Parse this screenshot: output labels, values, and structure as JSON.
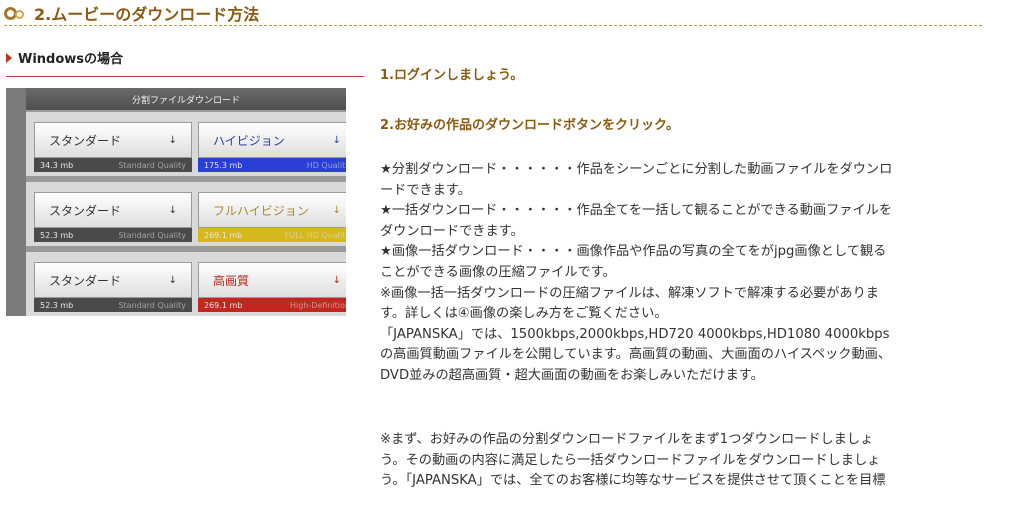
{
  "section": {
    "title": "2.ムービーのダウンロード方法"
  },
  "sub": {
    "title": "Windowsの場合"
  },
  "panel": {
    "header": "分割ファイルダウンロード",
    "arrow": "↓",
    "rows": [
      {
        "left": {
          "label": "スタンダード",
          "size": "34.3 mb",
          "quality": "Standard Quality"
        },
        "right": {
          "label": "ハイビジョン",
          "size": "175.3 mb",
          "quality": "HD Quality",
          "bar_color": "#2a3fd6",
          "label_color": "#2b3fa8"
        }
      },
      {
        "left": {
          "label": "スタンダード",
          "size": "52.3 mb",
          "quality": "Standard Quality"
        },
        "right": {
          "label": "フルハイビジョン",
          "size": "269.1 mb",
          "quality": "FULL HD Quality",
          "bar_color": "#d4b81c",
          "label_color": "#a88a2a"
        }
      },
      {
        "left": {
          "label": "スタンダード",
          "size": "52.3 mb",
          "quality": "Standard Quality"
        },
        "right": {
          "label": "高画質",
          "size": "269.1 mb",
          "quality": "High-Definition",
          "bar_color": "#c2261e",
          "label_color": "#b02a20"
        }
      }
    ]
  },
  "steps": {
    "s1": "1.ログインしましょう。",
    "s2": "2.お好みの作品のダウンロードボタンをクリック。"
  },
  "body": {
    "lines": [
      "★分割ダウンロード・・・・・・作品をシーンごとに分割した動画ファイルをダウンロ",
      "ードできます。",
      "★一括ダウンロード・・・・・・作品全てを一括して観ることができる動画ファイルを",
      "ダウンロードできます。",
      "★画像一括ダウンロード・・・・画像作品や作品の写真の全てをがjpg画像として観る",
      "ことができる画像の圧縮ファイルです。",
      "※画像一括一括ダウンロードの圧縮ファイルは、解凍ソフトで解凍する必要がありま",
      "す。詳しくは④画像の楽しみ方をご覧ください。",
      "「JAPANSKA」では、1500kbps,2000kbps,HD720 4000kbps,HD1080 4000kbps",
      "の高画質動画ファイルを公開しています。高画質の動画、大画面のハイスペック動画、",
      "DVD並みの超高画質・超大画面の動画をお楽しみいただけます。"
    ],
    "lines2": [
      "※まず、お好みの作品の分割ダウンロードファイルをまず1つダウンロードしましょ",
      "う。その動画の内容に満足したら一括ダウンロードファイルをダウンロードしましょ",
      "う。「JAPANSKA」では、全てのお客様に均等なサービスを提供させて頂くことを目標"
    ]
  }
}
